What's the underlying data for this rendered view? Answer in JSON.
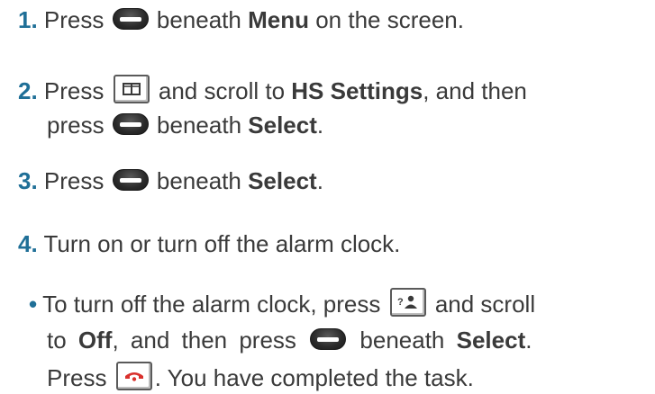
{
  "steps": [
    {
      "number": "1.",
      "parts": [
        "Press",
        "beneath",
        "Menu",
        "on the screen."
      ]
    },
    {
      "number": "2.",
      "line1": [
        "Press",
        "and scroll to",
        "HS Settings",
        ", and then"
      ],
      "line2": [
        "press",
        "beneath",
        "Select",
        "."
      ]
    },
    {
      "number": "3.",
      "parts": [
        "Press",
        "beneath",
        "Select",
        "."
      ]
    },
    {
      "number": "4.",
      "text": "Turn on or turn off the alarm clock."
    }
  ],
  "bullet": {
    "symbol": "•",
    "line1": [
      "To turn off the alarm clock, press",
      "and scroll"
    ],
    "line2": [
      "to",
      "Off",
      ", and then press",
      "beneath",
      "Select",
      "."
    ],
    "line3": [
      "Press",
      ". You have completed the task."
    ]
  },
  "icons": {
    "soft_key": "soft-key-icon",
    "phonebook_key": "phonebook-key-icon",
    "contacts_key": "contacts-key-icon",
    "end_call_key": "end-call-key-icon",
    "end_call_color": "#d9302c"
  }
}
